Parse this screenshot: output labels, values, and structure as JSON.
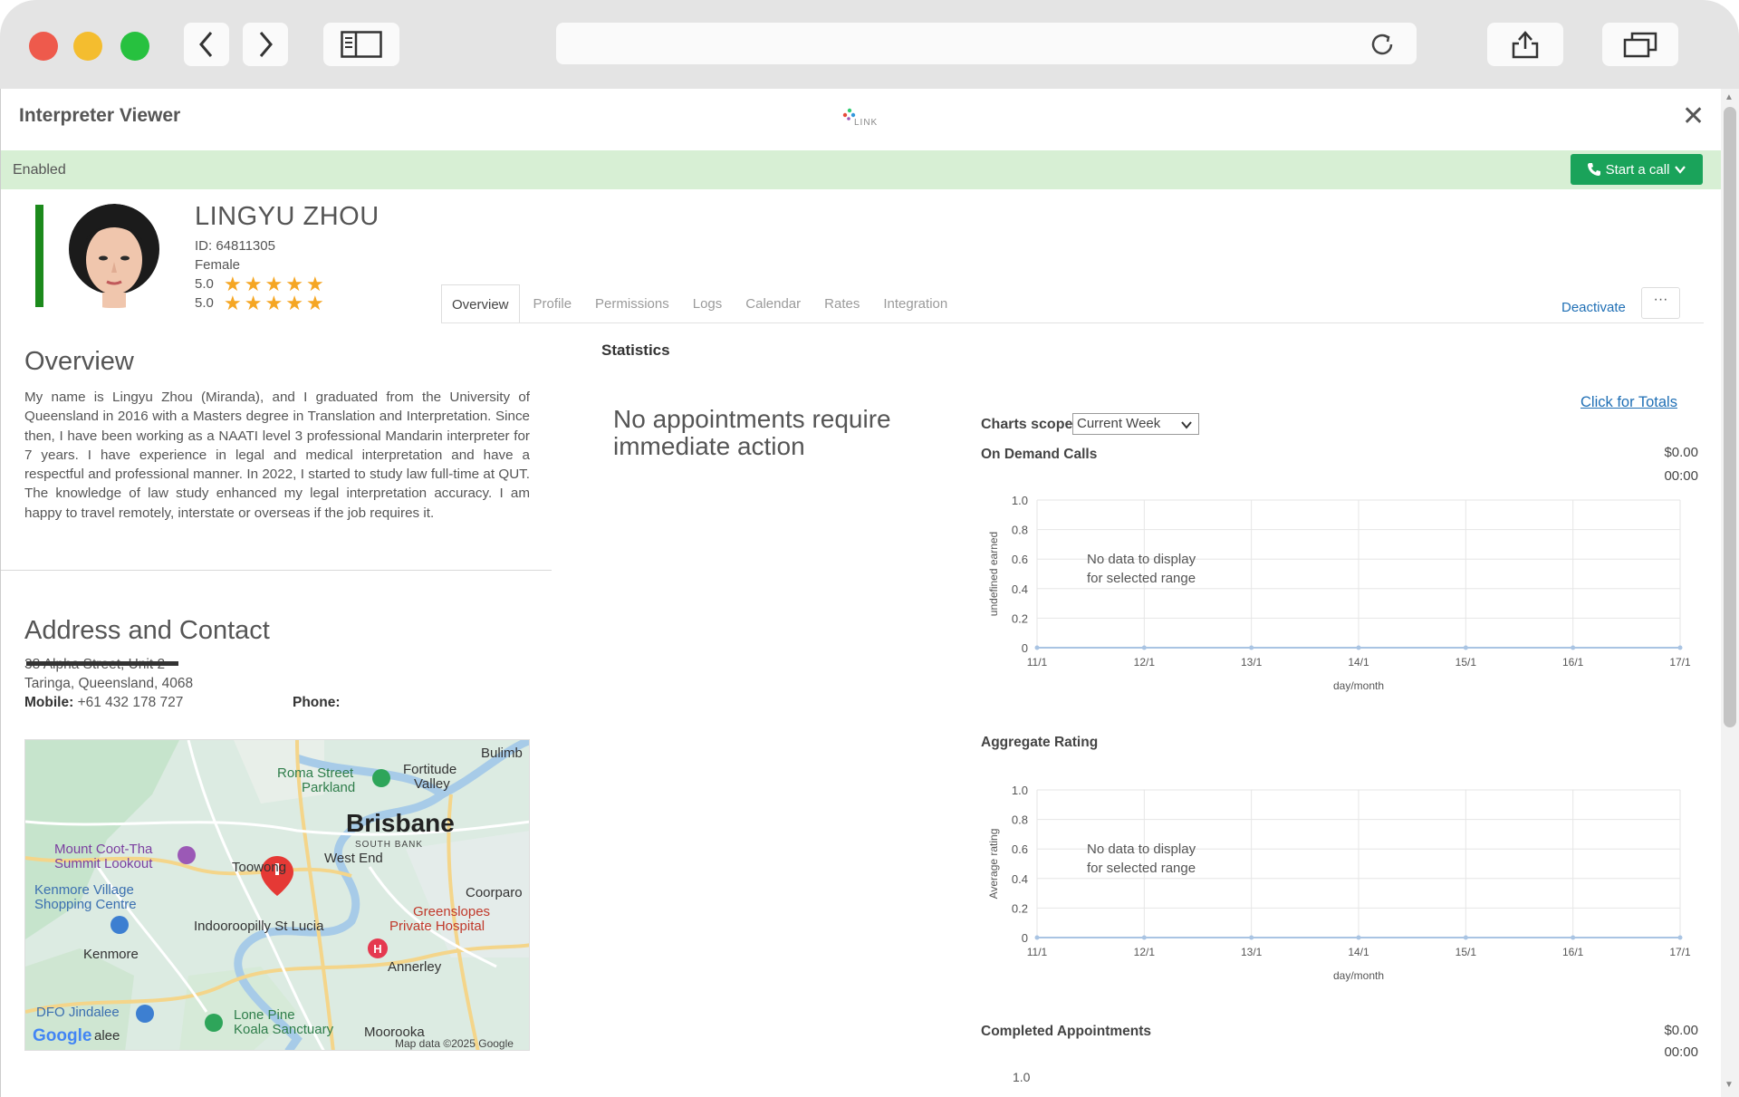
{
  "window": {
    "title": "Interpreter Viewer",
    "logo_word": "LINK"
  },
  "status": {
    "label": "Enabled",
    "call_button": "Start a call"
  },
  "profile": {
    "name": "LINGYU ZHOU",
    "id_line": "ID: 64811305",
    "gender": "Female",
    "ratings": [
      {
        "value": "5.0",
        "stars": 5
      },
      {
        "value": "5.0",
        "stars": 5
      }
    ]
  },
  "tabs": [
    "Overview",
    "Profile",
    "Permissions",
    "Logs",
    "Calendar",
    "Rates",
    "Integration"
  ],
  "actions": {
    "deactivate": "Deactivate",
    "more": "···"
  },
  "overview": {
    "heading": "Overview",
    "text": "My name is Lingyu Zhou (Miranda), and I graduated from the University of Queensland in 2016 with a Masters degree in Translation and Interpretation. Since then, I have been working as a NAATI level 3 professional Mandarin interpreter for 7 years. I have experience in legal and medical interpretation and have a respectful and professional manner. In 2022, I started to study law full-time at QUT. The knowledge of law study enhanced my legal interpretation accuracy. I am happy to travel remotely, interstate or overseas if the job requires it."
  },
  "contact": {
    "heading": "Address and Contact",
    "street": "38 Alpha Street, Unit 2",
    "suburb": "Taringa, Queensland, 4068",
    "mobile_label": "Mobile:",
    "mobile": "+61 432 178 727",
    "phone_label": "Phone:"
  },
  "map": {
    "labels": {
      "bulimba": "Bulimb",
      "roma": "Roma Street",
      "parkland": "Parkland",
      "fortitude1": "Fortitude",
      "fortitude2": "Valley",
      "brisbane": "Brisbane",
      "southbank": "SOUTH BANK",
      "westend": "West End",
      "coot1": "Mount Coot-Tha",
      "coot2": "Summit Lookout",
      "toowong": "Toowong",
      "kenmore_v1": "Kenmore Village",
      "kenmore_v2": "Shopping Centre",
      "coorparoo": "Coorparo",
      "greenslopes1": "Greenslopes",
      "greenslopes2": "Private Hospital",
      "indoo": "Indooroopilly St Lucia",
      "kenmore": "Kenmore",
      "annerley": "Annerley",
      "dfo": "DFO Jindalee",
      "jindalee": "alee",
      "lonepine1": "Lone Pine",
      "lonepine2": "Koala Sanctuary",
      "moorooka": "Moorooka",
      "attribution": "Map data ©2025 Google",
      "google": "Google"
    }
  },
  "stats": {
    "heading": "Statistics",
    "no_appointments": "No appointments require immediate action",
    "click_totals": "Click for Totals",
    "scope_label": "Charts scope",
    "scope_value": "Current Week",
    "charts": [
      {
        "title": "On Demand Calls",
        "amount": "$0.00",
        "time": "00:00"
      },
      {
        "title": "Aggregate Rating"
      },
      {
        "title": "Completed Appointments",
        "amount": "$0.00",
        "time": "00:00"
      }
    ]
  },
  "chart_data": [
    {
      "type": "line",
      "title": "On Demand Calls",
      "xlabel": "day/month",
      "ylabel": "undefined earned",
      "categories": [
        "11/1",
        "12/1",
        "13/1",
        "14/1",
        "15/1",
        "16/1",
        "17/1"
      ],
      "values": [
        0,
        0,
        0,
        0,
        0,
        0,
        0
      ],
      "ylim": [
        0,
        1.0
      ],
      "yticks": [
        "0",
        "0.2",
        "0.4",
        "0.6",
        "0.8",
        "1.0"
      ],
      "annotation": "No data to display for selected range",
      "grid": true,
      "line_color": "#a9c4e3"
    },
    {
      "type": "line",
      "title": "Aggregate Rating",
      "xlabel": "day/month",
      "ylabel": "Average rating",
      "categories": [
        "11/1",
        "12/1",
        "13/1",
        "14/1",
        "15/1",
        "16/1",
        "17/1"
      ],
      "values": [
        0,
        0,
        0,
        0,
        0,
        0,
        0
      ],
      "ylim": [
        0,
        1.0
      ],
      "yticks": [
        "0",
        "0.2",
        "0.4",
        "0.6",
        "0.8",
        "1.0"
      ],
      "annotation": "No data to display for selected range",
      "grid": true,
      "line_color": "#a9c4e3"
    },
    {
      "type": "line",
      "title": "Completed Appointments",
      "yticks": [
        "1.0"
      ]
    }
  ]
}
